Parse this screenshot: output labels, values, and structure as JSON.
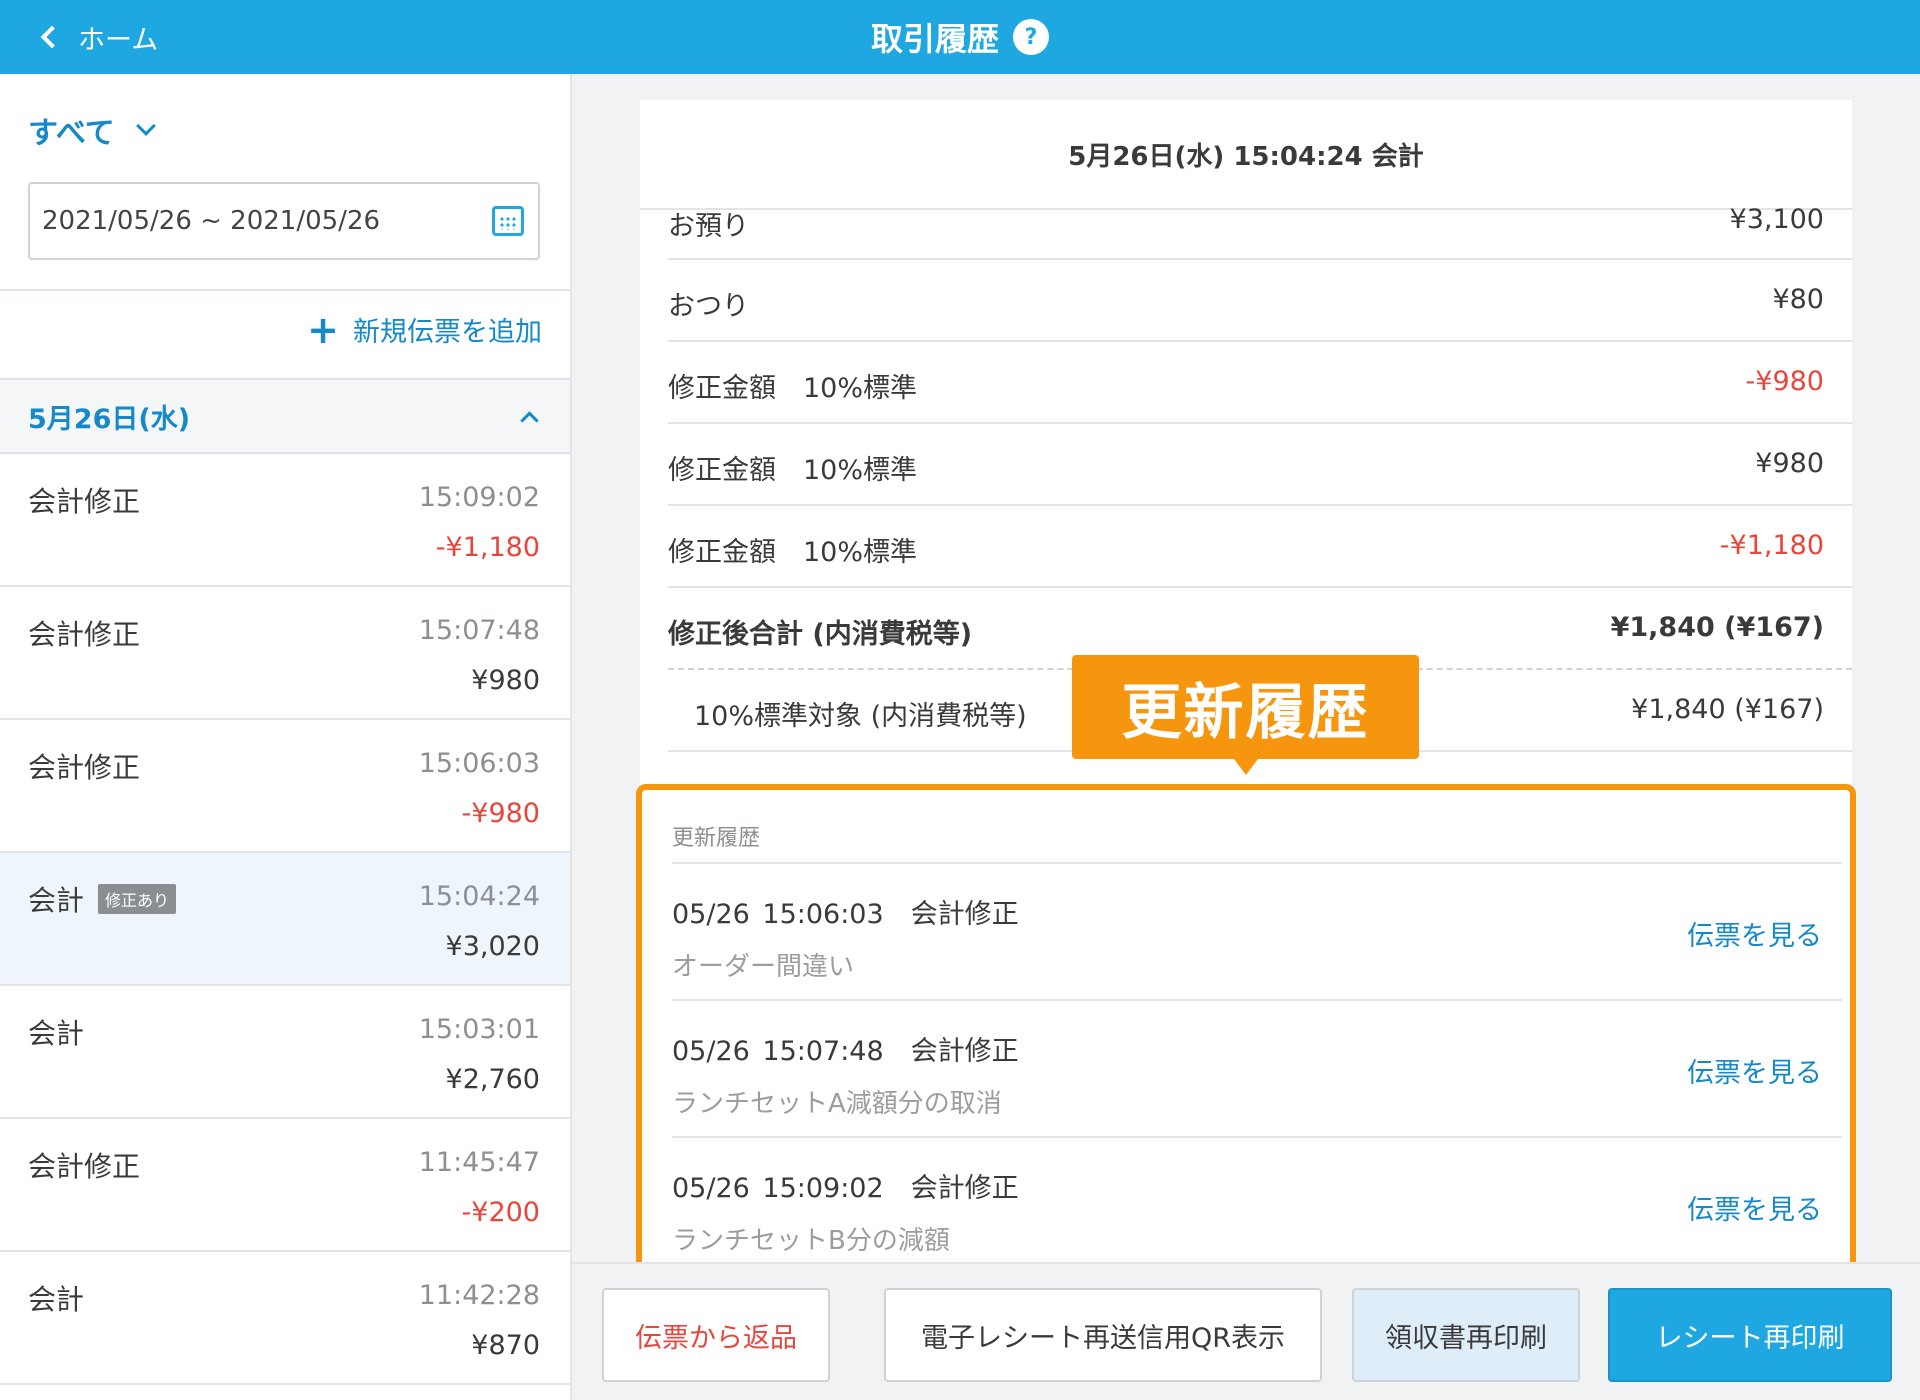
{
  "header": {
    "back_label": "ホーム",
    "title": "取引履歴",
    "help_glyph": "?"
  },
  "sidebar": {
    "filter_label": "すべて",
    "date_range_value": "2021/05/26 ~ 2021/05/26",
    "add_slip_label": "新規伝票を追加",
    "day_label": "5月26日(水)",
    "transactions": [
      {
        "kind": "会計修正",
        "badge": "",
        "time": "15:09:02",
        "amount": "-¥1,180",
        "negative": true
      },
      {
        "kind": "会計修正",
        "badge": "",
        "time": "15:07:48",
        "amount": "¥980",
        "negative": false
      },
      {
        "kind": "会計修正",
        "badge": "",
        "time": "15:06:03",
        "amount": "-¥980",
        "negative": true
      },
      {
        "kind": "会計",
        "badge": "修正あり",
        "time": "15:04:24",
        "amount": "¥3,020",
        "negative": false,
        "selected": true
      },
      {
        "kind": "会計",
        "badge": "",
        "time": "15:03:01",
        "amount": "¥2,760",
        "negative": false
      },
      {
        "kind": "会計修正",
        "badge": "",
        "time": "11:45:47",
        "amount": "-¥200",
        "negative": true
      },
      {
        "kind": "会計",
        "badge": "",
        "time": "11:42:28",
        "amount": "¥870",
        "negative": false
      }
    ]
  },
  "detail": {
    "title": "5月26日(水) 15:04:24 会計",
    "rows": [
      {
        "label": "お預り",
        "value": "¥3,100",
        "negative": false
      },
      {
        "label": "おつり",
        "value": "¥80",
        "negative": false
      },
      {
        "label": "修正金額　10%標準",
        "value": "-¥980",
        "negative": true
      },
      {
        "label": "修正金額　10%標準",
        "value": "¥980",
        "negative": false
      },
      {
        "label": "修正金額　10%標準",
        "value": "-¥1,180",
        "negative": true
      }
    ],
    "total_label": "修正後合計 (内消費税等)",
    "total_value": "¥1,840 (¥167)",
    "taxable_label": "10%標準対象 (内消費税等)",
    "taxable_value": "¥1,840 (¥167)"
  },
  "callout_label": "更新履歴",
  "history": {
    "heading": "更新履歴",
    "items": [
      {
        "when": "05/26 15:06:03",
        "type": "会計修正",
        "note": "オーダー間違い",
        "link": "伝票を見る"
      },
      {
        "when": "05/26 15:07:48",
        "type": "会計修正",
        "note": "ランチセットA減額分の取消",
        "link": "伝票を見る"
      },
      {
        "when": "05/26 15:09:02",
        "type": "会計修正",
        "note": "ランチセットB分の減額",
        "link": "伝票を見る"
      }
    ]
  },
  "buttons": {
    "return_label": "伝票から返品",
    "qr_label": "電子レシート再送信用QR表示",
    "receipt_label": "領収書再印刷",
    "reprint_label": "レシート再印刷"
  },
  "colors": {
    "header": "#1fa7e1",
    "accent": "#1689c9",
    "negative": "#e8463c",
    "callout": "#f6960f"
  }
}
